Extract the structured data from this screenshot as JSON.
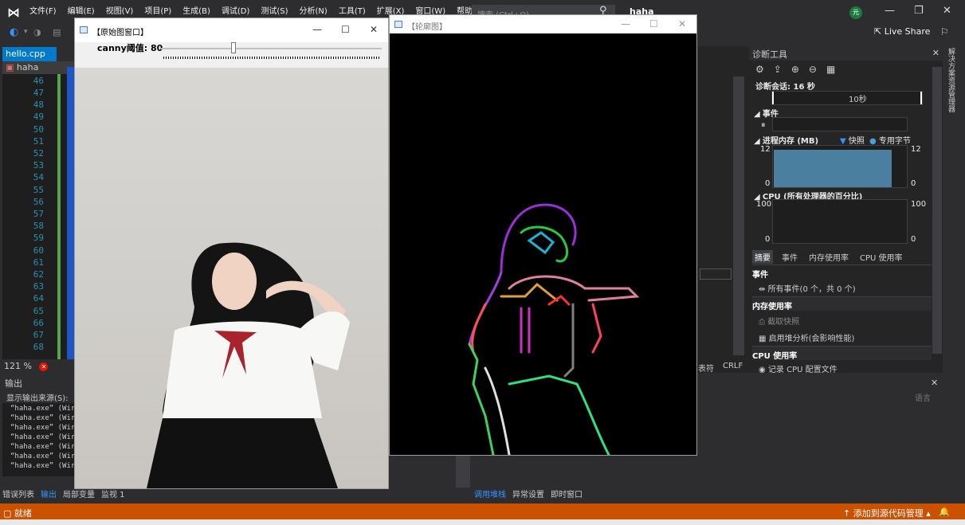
{
  "menu": [
    "文件(F)",
    "编辑(E)",
    "视图(V)",
    "项目(P)",
    "生成(B)",
    "调试(D)",
    "测试(S)",
    "分析(N)",
    "工具(T)",
    "扩展(X)",
    "窗口(W)",
    "帮助(H)"
  ],
  "search_placeholder": "搜索 (Ctrl+Q)",
  "solution_name": "haha",
  "avatar_initial": "元",
  "live_share": "Live Share",
  "editor": {
    "tab_name": "hello.cpp",
    "tab_pin": "⊸",
    "nav_label": "haha",
    "line_numbers": [
      "46",
      "47",
      "48",
      "49",
      "50",
      "51",
      "52",
      "53",
      "54",
      "55",
      "56",
      "57",
      "58",
      "59",
      "60",
      "61",
      "62",
      "63",
      "64",
      "65",
      "66",
      "67",
      "68"
    ],
    "zoom": "121 %"
  },
  "output": {
    "title": "输出",
    "source_label": "显示输出来源(S):",
    "lines": [
      "“haha.exe” (Wir",
      "“haha.exe” (Wir",
      "“haha.exe” (Wir",
      "“haha.exe” (Wir",
      "“haha.exe” (Wir",
      "“haha.exe” (Wir",
      "“haha.exe” (Wir"
    ]
  },
  "bottom_tabs_left": [
    {
      "label": "错误列表",
      "active": false
    },
    {
      "label": "输出",
      "active": true
    },
    {
      "label": "局部变量",
      "active": false
    },
    {
      "label": "监视 1",
      "active": false
    }
  ],
  "bottom_tabs_right": [
    {
      "label": "调用堆栈",
      "active": true
    },
    {
      "label": "异常设置",
      "active": false
    },
    {
      "label": "即时窗口",
      "active": false
    }
  ],
  "diagnostics": {
    "title": "诊断工具",
    "session": "诊断会话: 16 秒",
    "timeline_label": "10秒",
    "events_header": "事件",
    "memory_header": "进程内存 (MB)",
    "snapshot_legend": "快照",
    "private_legend": "专用字节",
    "mem_max": "12",
    "mem_min": "0",
    "cpu_header": "CPU (所有处理器的百分比)",
    "cpu_max": "100",
    "cpu_min": "0",
    "tabs": [
      {
        "label": "摘要",
        "active": true
      },
      {
        "label": "事件",
        "active": false
      },
      {
        "label": "内存使用率",
        "active": false
      },
      {
        "label": "CPU 使用率",
        "active": false
      }
    ],
    "sec_events": "事件",
    "all_events": "所有事件(0 个，共 0 个)",
    "sec_memory": "内存使用率",
    "take_snapshot": "截取快照",
    "heap_analysis": "启用堆分析(会影响性能)",
    "sec_cpu": "CPU 使用率",
    "record_cpu": "记录 CPU 配置文件"
  },
  "right_rail": "解决方案资源管理器",
  "status": {
    "ready": "就绪",
    "source_control": "添加到源代码管理",
    "crlf": "CRLF",
    "encoding_short": "表符",
    "lang_hint": "语言"
  },
  "cv_original": {
    "title": "【原始图窗口】",
    "trackbar_label": "canny阈值: 80",
    "trackbar_value": 80,
    "trackbar_max": 255
  },
  "cv_contour": {
    "title": "【轮廓图】"
  }
}
